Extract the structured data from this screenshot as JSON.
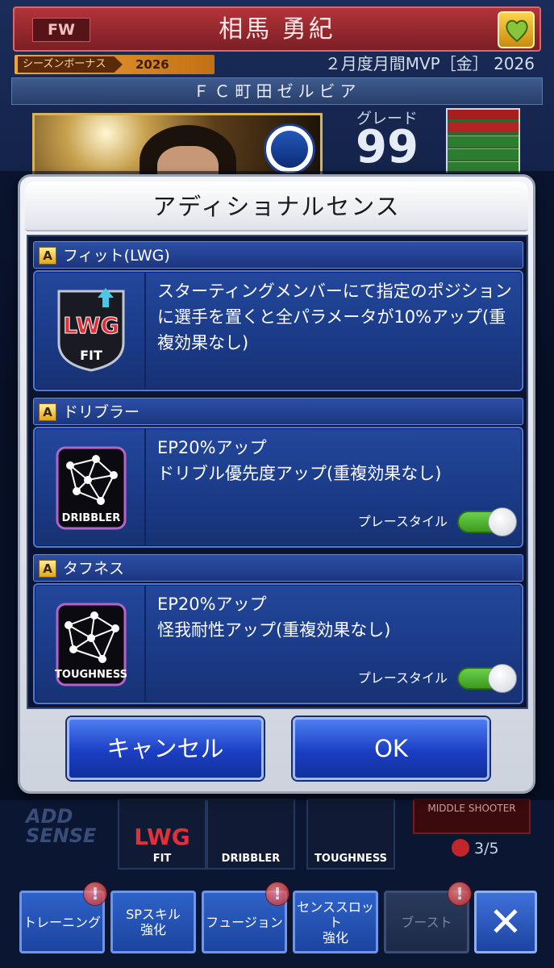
{
  "header": {
    "position": "FW",
    "player_name": "相馬 勇紀",
    "favorite_icon": "heart-icon"
  },
  "bonus": {
    "label": "シーズンボーナス",
    "year": "2026",
    "mvp_text": "２月度月間MVP［金］ 2026"
  },
  "team": "ＦＣ町田ゼルビア",
  "grade": {
    "label": "グレード",
    "value": "99"
  },
  "dialog": {
    "title": "アディショナルセンス",
    "senses": [
      {
        "rank": "A",
        "name": "フィット(LWG)",
        "icon_label": "LWG",
        "icon_sub": "FIT",
        "description": "スターティングメンバーにて指定のポジションに選手を置くと全パラメータが10%アップ(重複効果なし)"
      },
      {
        "rank": "A",
        "name": "ドリブラー",
        "icon_label": "DRIBBLER",
        "line1": "EP20%アップ",
        "line2": "ドリブル優先度アップ(重複効果なし)",
        "playstyle_label": "プレースタイル",
        "playstyle_on": true
      },
      {
        "rank": "A",
        "name": "タフネス",
        "icon_label": "TOUGHNESS",
        "line1": "EP20%アップ",
        "line2": "怪我耐性アップ(重複効果なし)",
        "playstyle_label": "プレースタイル",
        "playstyle_on": true
      }
    ],
    "cancel_label": "キャンセル",
    "ok_label": "OK"
  },
  "background": {
    "add_sense_line1": "ADD",
    "add_sense_line2": "SENSE",
    "icons": [
      {
        "label": "LWG",
        "sub": "FIT"
      },
      {
        "label": "DRIBBLER"
      },
      {
        "label": "TOUGHNESS"
      }
    ],
    "slot_card_text": "MIDDLE SHOOTER",
    "slot_count": "3/5"
  },
  "nav": {
    "training": "トレーニング",
    "sp_skill_line1": "SPスキル",
    "sp_skill_line2": "強化",
    "fusion": "フュージョン",
    "sense_slot_line1": "センススロット",
    "sense_slot_line2": "強化",
    "boost": "ブースト",
    "close_icon": "close-icon"
  },
  "colors": {
    "header_red": "#b2343a",
    "dialog_blue": "#1a3a86",
    "toggle_green": "#4cb028",
    "button_blue": "#1b3fc4"
  }
}
